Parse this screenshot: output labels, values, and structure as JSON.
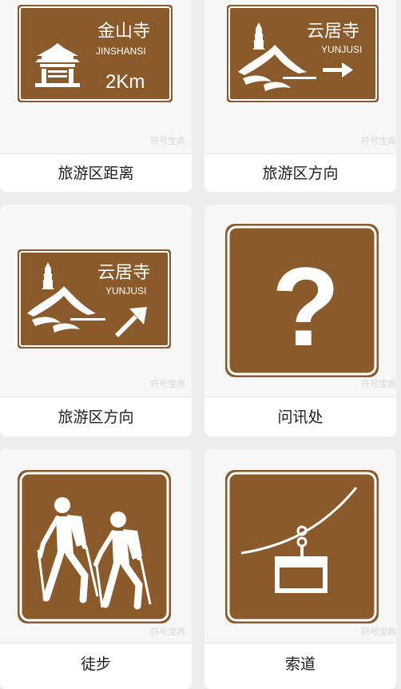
{
  "colors": {
    "sign_brown": "#8a5a2b",
    "sign_white": "#ffffff",
    "page_bg": "#ededed"
  },
  "watermark": "符号宝典",
  "cards": [
    {
      "caption": "旅游区距离",
      "sign": {
        "name_cn": "金山寺",
        "name_en": "JINSHANSI",
        "distance": "2Km",
        "icon": "temple-pavilion-icon"
      }
    },
    {
      "caption": "旅游区方向",
      "sign": {
        "name_cn": "云居寺",
        "name_en": "YUNJUSI",
        "icon": "pagoda-mountain-icon",
        "arrow": "arrow-right-icon"
      }
    },
    {
      "caption": "旅游区方向",
      "sign": {
        "name_cn": "云居寺",
        "name_en": "YUNJUSI",
        "icon": "pagoda-mountain-icon",
        "arrow": "arrow-up-right-icon"
      }
    },
    {
      "caption": "问讯处",
      "sign": {
        "symbol": "?",
        "icon": "question-mark-icon"
      }
    },
    {
      "caption": "徒步",
      "sign": {
        "icon": "hikers-icon"
      }
    },
    {
      "caption": "索道",
      "sign": {
        "icon": "cable-car-icon"
      }
    }
  ]
}
